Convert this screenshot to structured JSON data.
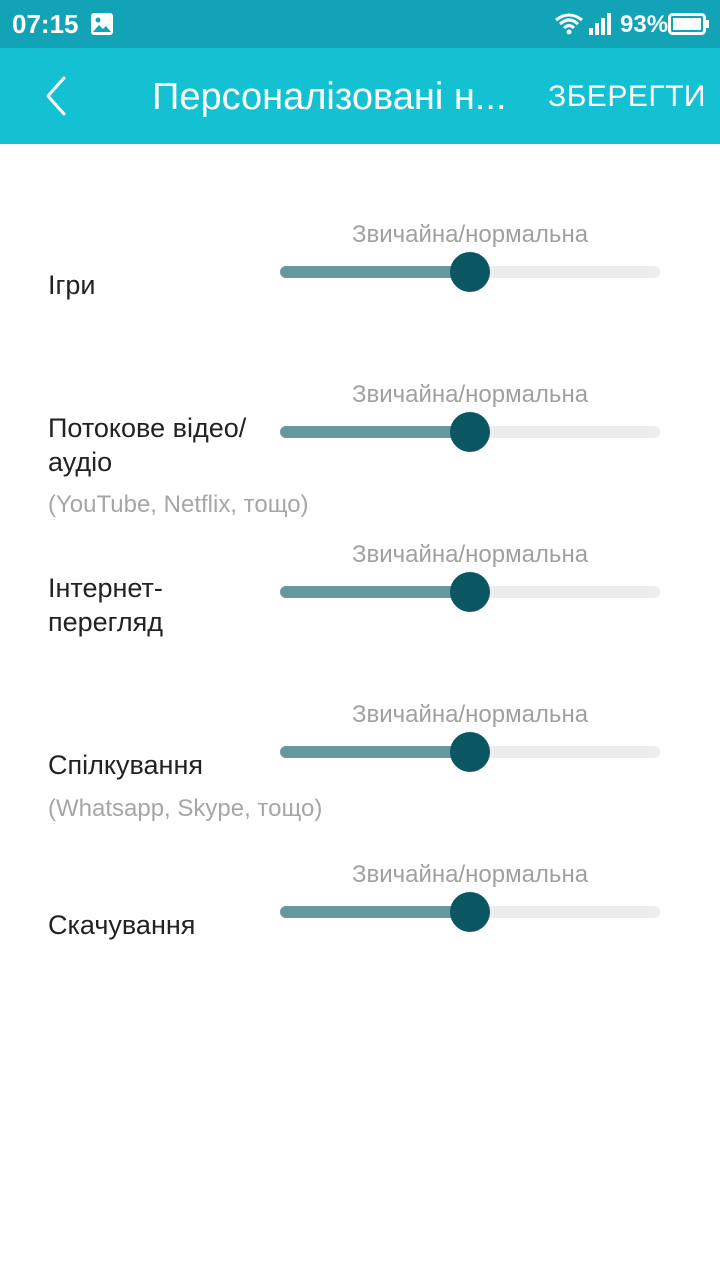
{
  "status_bar": {
    "time": "07:15",
    "battery_percent": "93%",
    "icons": [
      "gallery-icon",
      "wifi-icon",
      "signal-icon",
      "battery-icon"
    ]
  },
  "app_bar": {
    "title": "Персоналізовані н...",
    "save_label": "ЗБЕРЕГТИ",
    "back_icon": "chevron-left-icon"
  },
  "colors": {
    "status_bar": "#12a3b6",
    "app_bar": "#13c1d2",
    "slider_fill": "#66999f",
    "slider_thumb": "#0b5663",
    "slider_track": "#ededed"
  },
  "items": [
    {
      "label": "Ігри",
      "sublabel": "",
      "level_label": "Звичайна/нормальна",
      "value": 0.5
    },
    {
      "label": "Потокове відео/аудіо",
      "sublabel": "(YouTube, Netflix, тощо)",
      "level_label": "Звичайна/нормальна",
      "value": 0.5
    },
    {
      "label": "Інтернет-перегляд",
      "sublabel": "",
      "level_label": "Звичайна/нормальна",
      "value": 0.5
    },
    {
      "label": "Спілкування",
      "sublabel": "(Whatsapp, Skype, тощо)",
      "level_label": "Звичайна/нормальна",
      "value": 0.5
    },
    {
      "label": "Скачування",
      "sublabel": "",
      "level_label": "Звичайна/нормальна",
      "value": 0.5
    }
  ]
}
